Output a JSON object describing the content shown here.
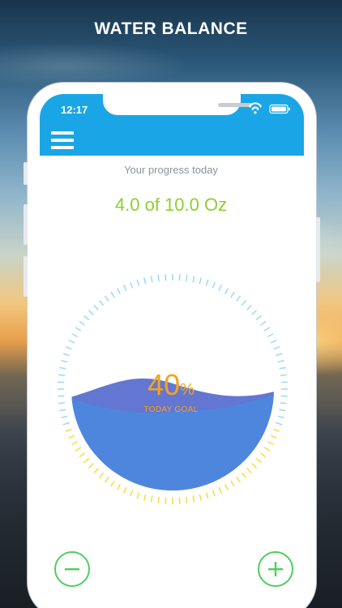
{
  "page": {
    "title": "WATER BALANCE"
  },
  "status_bar": {
    "time": "12:17",
    "icons": [
      "wifi-icon",
      "battery-icon"
    ]
  },
  "app_bar": {
    "menu_icon": "hamburger-menu-icon",
    "color": "#1aa6e6"
  },
  "progress": {
    "label": "Your progress today",
    "value_text": "4.0 of 10.0 Oz",
    "value_color": "#8ccf2e"
  },
  "gauge": {
    "percent_value": "40",
    "percent_sign": "%",
    "subtitle": "TODAY GOAL",
    "fill_fraction": 0.4,
    "water_color": "#4f86dd",
    "accent_color": "#f3a51e"
  },
  "controls": {
    "decrease_icon": "minus-icon",
    "increase_icon": "plus-icon",
    "color": "#4fce5d"
  }
}
